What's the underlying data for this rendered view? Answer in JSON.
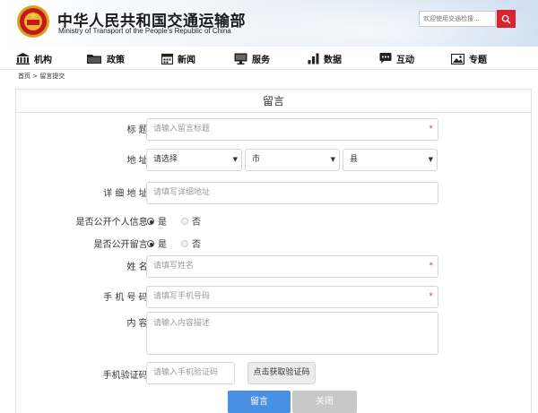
{
  "header": {
    "title": "中华人民共和国交通运输部",
    "subtitle": "Ministry of Transport of the People's Republic of China",
    "search_placeholder": "欢迎使用交通检搜...",
    "emblem_icon": "national-emblem-icon",
    "search_icon": "search-icon"
  },
  "nav": {
    "items": [
      {
        "label": "机构",
        "icon": "building-icon"
      },
      {
        "label": "政策",
        "icon": "folder-icon"
      },
      {
        "label": "新闻",
        "icon": "calendar-icon"
      },
      {
        "label": "服务",
        "icon": "monitor-icon"
      },
      {
        "label": "数据",
        "icon": "bar-chart-icon"
      },
      {
        "label": "互动",
        "icon": "chat-icon"
      },
      {
        "label": "专题",
        "icon": "image-icon"
      }
    ]
  },
  "breadcrumb": {
    "home": "首页",
    "sep": " > ",
    "current": "留言提交"
  },
  "form": {
    "title": "留言",
    "required_mark": "*",
    "fields": {
      "subject": {
        "label": "标 题:",
        "placeholder": "请输入留言标题"
      },
      "address": {
        "label": "地 址:",
        "province": "请选择",
        "city": "市",
        "county": "县"
      },
      "detail_address": {
        "label": "详 细 地 址:",
        "placeholder": "请填写详细地址"
      },
      "public_info": {
        "label": "是否公开个人信息:",
        "yes": "是",
        "no": "否",
        "selected": "是"
      },
      "public_message": {
        "label": "是否公开留言:",
        "yes": "是",
        "no": "否",
        "selected": "是"
      },
      "name": {
        "label": "姓 名:",
        "placeholder": "请填写姓名"
      },
      "phone": {
        "label": "手 机 号 码:",
        "placeholder": "请填写手机号码"
      },
      "content": {
        "label": "内 容:",
        "placeholder": "请输入内容描述"
      },
      "sms_code": {
        "label": "手机验证码:",
        "placeholder": "请输入手机验证码",
        "button": "点击获取验证码"
      }
    },
    "buttons": {
      "submit": "留言",
      "close": "关闭"
    }
  },
  "colors": {
    "accent": "#4a90e2",
    "search_button": "#d9232d",
    "required": "#e33333"
  }
}
